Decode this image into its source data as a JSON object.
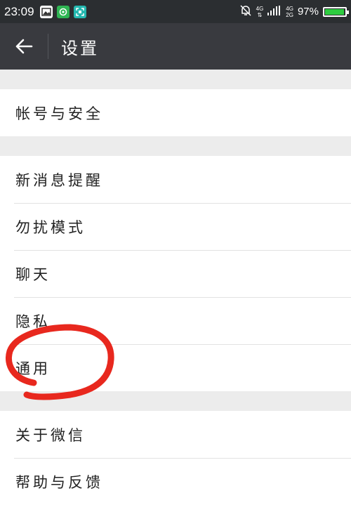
{
  "status_bar": {
    "time": "23:09",
    "network_top": "4G",
    "network_right_top": "4G",
    "network_right_bottom": "2G",
    "battery": "97%",
    "battery_level": 0.97,
    "icons": [
      "gallery-app-icon",
      "green-app-icon",
      "scan-app-icon",
      "mute-bell-icon",
      "signal-icon",
      "battery-icon"
    ]
  },
  "header": {
    "back_icon": "arrow-left-icon",
    "title": "设置"
  },
  "groups": [
    {
      "items": [
        {
          "label": "帐号与安全"
        }
      ]
    },
    {
      "items": [
        {
          "label": "新消息提醒"
        },
        {
          "label": "勿扰模式"
        },
        {
          "label": "聊天"
        },
        {
          "label": "隐私"
        },
        {
          "label": "通用"
        }
      ]
    },
    {
      "items": [
        {
          "label": "关于微信"
        },
        {
          "label": "帮助与反馈"
        }
      ]
    }
  ],
  "colors": {
    "status_bar": "#2b2e31",
    "header": "#393a3f",
    "annotation": "#e8281e",
    "background": "#ececec"
  }
}
